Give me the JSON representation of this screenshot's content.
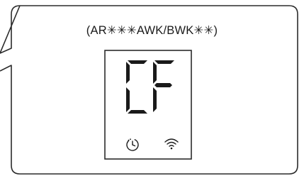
{
  "model_label": "(AR✳✳✳AWK/BWK✳✳)",
  "display": {
    "error_code": "CF"
  },
  "icons": {
    "timer": "timer-icon",
    "wifi": "wifi-icon"
  },
  "colors": {
    "segments": "#1a1a1a",
    "outline": "#2b2b2b",
    "background": "#ffffff"
  }
}
